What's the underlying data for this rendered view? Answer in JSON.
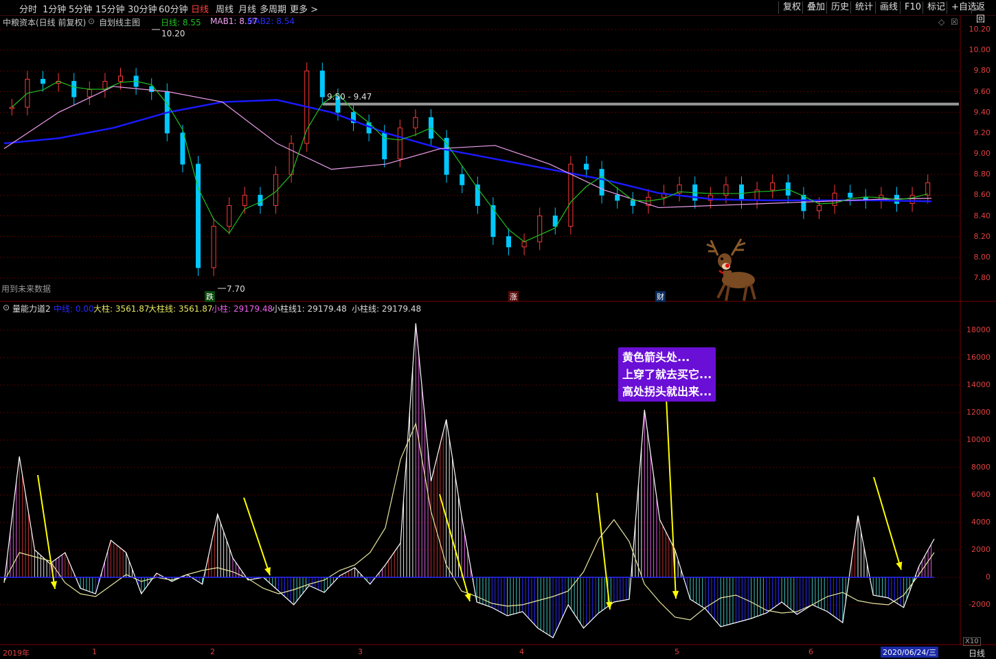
{
  "topbar": {
    "tabs": [
      "分时",
      "1分钟",
      "5分钟",
      "15分钟",
      "30分钟",
      "60分钟",
      "日线",
      "周线",
      "月线",
      "多周期",
      "更多 >"
    ],
    "active": "日线",
    "right_buttons": [
      "复权",
      "叠加",
      "历史",
      "统计",
      "画线",
      "F10",
      "标记",
      "+自选",
      "返回"
    ]
  },
  "main": {
    "stock_label": "中粮资本(日线 前复权)",
    "chart_name": "自划线主图",
    "ma_line_label": "日线: 8.55",
    "mab1_label": "MAB1: 8.57",
    "mab2_label": "MAB2: 8.54",
    "high_label": "10.20",
    "low_label": "7.70",
    "hline_label": "9.50 - 9.47",
    "future_note": "用到未来数据",
    "tag_die": "跌",
    "tag_zhang": "涨",
    "tag_cai": "财",
    "price_ticks": [
      "10.20",
      "10.00",
      "9.80",
      "9.60",
      "9.40",
      "9.20",
      "9.00",
      "8.80",
      "8.60",
      "8.40",
      "8.20",
      "8.00",
      "7.80"
    ],
    "colors": {
      "up": "#ff3a3a",
      "down": "#00c8ff",
      "green": "#22c022",
      "pink": "#f0a0f0",
      "blue": "#1a1aff",
      "grey": "#999999"
    }
  },
  "sub": {
    "indicator": "量能力道2",
    "zhongxian": "中线: 0.00",
    "dazhu": "大柱: 3561.87",
    "dazhuxian": "大柱线: 3561.87",
    "xiaozhu": "小柱: 29179.48",
    "xiaozhuxian1": "小柱线1: 29179.48",
    "xiaozhuxian": "小柱线: 29179.48",
    "vol_ticks": [
      "18000",
      "16000",
      "14000",
      "12000",
      "10000",
      "8000",
      "6000",
      "4000",
      "2000",
      "0",
      "-2000"
    ],
    "x10": "X10"
  },
  "annotation": {
    "line1": "黄色箭头处...",
    "line2": "上穿了就去买它...",
    "line3": "高处拐头就出来..."
  },
  "xaxis": {
    "months": [
      "2019年",
      "1",
      "2",
      "3",
      "4",
      "5",
      "6"
    ],
    "date_box": "2020/06/24/三",
    "period": "日线"
  },
  "chart_data": [
    {
      "type": "candlestick",
      "title": "中粮资本(日线 前复权)",
      "ylim": [
        7.7,
        10.3
      ],
      "hline": 9.48,
      "series": [
        {
          "name": "MAB2",
          "values": [
            9.1,
            9.15,
            9.25,
            9.4,
            9.5,
            9.52,
            9.4,
            9.2,
            9.05,
            8.95,
            8.85,
            8.75,
            8.62,
            8.56,
            8.55,
            8.55,
            8.55,
            8.54
          ]
        },
        {
          "name": "MAB1",
          "values": [
            9.05,
            9.4,
            9.65,
            9.6,
            9.5,
            9.1,
            8.85,
            8.9,
            9.05,
            9.08,
            8.9,
            8.65,
            8.48,
            8.5,
            8.52,
            8.54,
            8.56,
            8.57
          ]
        }
      ],
      "closes": [
        9.45,
        9.72,
        9.68,
        9.7,
        9.55,
        9.62,
        9.7,
        9.75,
        9.65,
        9.6,
        9.2,
        8.9,
        7.9,
        8.3,
        8.5,
        8.6,
        8.5,
        8.8,
        9.1,
        9.8,
        9.55,
        9.4,
        9.3,
        9.2,
        8.95,
        9.25,
        9.35,
        9.15,
        8.8,
        8.7,
        8.5,
        8.2,
        8.1,
        8.15,
        8.4,
        8.3,
        8.9,
        8.85,
        8.6,
        8.55,
        8.5,
        8.58,
        8.62,
        8.7,
        8.55,
        8.6,
        8.7,
        8.55,
        8.65,
        8.72,
        8.6,
        8.45,
        8.5,
        8.62,
        8.58,
        8.55,
        8.6,
        8.52,
        8.6,
        8.72
      ]
    },
    {
      "type": "bar",
      "title": "量能力道2",
      "ylim": [
        -4000,
        19000
      ],
      "series": [
        {
          "name": "小柱线",
          "values": [
            -400,
            8800,
            2000,
            1000,
            1800,
            -800,
            -1200,
            2700,
            1800,
            -1200,
            300,
            -300,
            200,
            -500,
            4600,
            1400,
            -200,
            0,
            -1000,
            -2000,
            -600,
            -1100,
            100,
            700,
            -500,
            900,
            2500,
            18500,
            7000,
            11500,
            4500,
            -1800,
            -2200,
            -2800,
            -2500,
            -3700,
            -4400,
            -2000,
            -3700,
            -2600,
            -1800,
            -1600,
            12200,
            4200,
            2000,
            -1600,
            -2300,
            -3600,
            -3300,
            -3000,
            -2600,
            -1800,
            -2700,
            -2000,
            -2500,
            -3300,
            4500,
            -1300,
            -1500,
            -2200,
            800,
            2800
          ]
        },
        {
          "name": "大柱线",
          "values": [
            -300,
            1800,
            1500,
            1200,
            -400,
            -1200,
            -1400,
            -600,
            200,
            -300,
            0,
            -200,
            200,
            500,
            700,
            400,
            -100,
            -800,
            -1200,
            -900,
            -500,
            -200,
            500,
            900,
            1800,
            3600,
            8600,
            11200,
            4800,
            900,
            -1000,
            -1400,
            -1900,
            -2100,
            -2000,
            -1700,
            -1400,
            -1000,
            400,
            2800,
            4200,
            2600,
            -500,
            -1800,
            -2900,
            -3100,
            -2200,
            -1500,
            -1300,
            -1800,
            -2400,
            -2600,
            -2500,
            -2000,
            -1400,
            -1100,
            -1700,
            -1900,
            -2000,
            -1300,
            200,
            1800
          ]
        }
      ]
    }
  ]
}
